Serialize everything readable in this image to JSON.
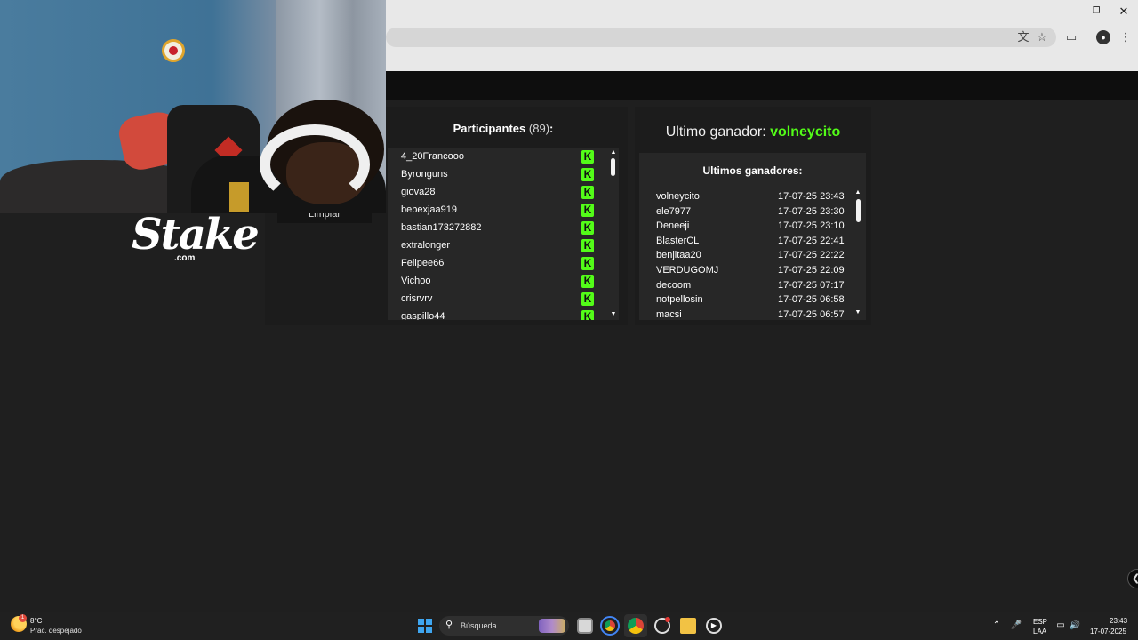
{
  "browser": {
    "translate_icon": "translate-icon",
    "bookmark_icon": "star-icon",
    "extensions_icon": "puzzle-icon",
    "profile_icon": "profile-avatar",
    "menu_icon": "kebab-menu-icon",
    "window_controls": [
      "minimize",
      "restore",
      "close"
    ]
  },
  "brand": {
    "word": "Stake",
    "suffix": ".com"
  },
  "controls": {
    "clear_label": "Limpiar"
  },
  "participants": {
    "title": "Participantes",
    "count": "(89)",
    "colon": ":",
    "badge_icon": "kick-icon",
    "badge_color": "#53fc18",
    "items": [
      "4_20Francooo",
      "Byronguns",
      "giova28",
      "bebexjaa919",
      "bastian173272882",
      "extralonger",
      "Felipee66",
      "Vichoo",
      "crisrvrv",
      "gaspillo44"
    ]
  },
  "last_winner": {
    "label": "Ultimo ganador:",
    "name": "volneycito",
    "name_color": "#53fc18"
  },
  "winners": {
    "title": "Ultimos ganadores:",
    "rows": [
      {
        "name": "volneycito",
        "date": "17-07-25 23:43"
      },
      {
        "name": "ele7977",
        "date": "17-07-25 23:30"
      },
      {
        "name": "Deneeji",
        "date": "17-07-25 23:10"
      },
      {
        "name": "BlasterCL",
        "date": "17-07-25 22:41"
      },
      {
        "name": "benjitaa20",
        "date": "17-07-25 22:22"
      },
      {
        "name": "VERDUGOMJ",
        "date": "17-07-25 22:09"
      },
      {
        "name": "decoom",
        "date": "17-07-25 07:17"
      },
      {
        "name": "notpellosin",
        "date": "17-07-25 06:58"
      },
      {
        "name": "macsi",
        "date": "17-07-25 06:57"
      }
    ]
  },
  "taskbar": {
    "weather_temp": "8°C",
    "weather_desc": "Prac. despejado",
    "weather_badge": "1",
    "search_placeholder": "Búsqueda",
    "lang_top": "ESP",
    "lang_bottom": "LAA",
    "time": "23:43",
    "date": "17-07-2025"
  }
}
